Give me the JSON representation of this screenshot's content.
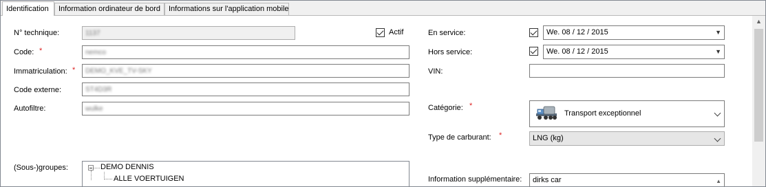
{
  "tabs": [
    {
      "label": "Identification"
    },
    {
      "label": "Information ordinateur de bord"
    },
    {
      "label": "Informations sur l'application mobile"
    }
  ],
  "left": {
    "technical_no": {
      "label": "N° technique:",
      "value": "1137"
    },
    "active": {
      "label": "Actif",
      "checked": true
    },
    "code": {
      "label": "Code:",
      "required": "*",
      "value": "nemco"
    },
    "registration": {
      "label": "Immatriculation:",
      "required": "*",
      "value": "DEMO_KVE_TV-SKY"
    },
    "external_code": {
      "label": "Code externe:",
      "value": "ST4D3R"
    },
    "autofilter": {
      "label": "Autofiltre:",
      "value": "wulke"
    },
    "groups": {
      "label": "(Sous-)groupes:",
      "tree": [
        {
          "label": "DEMO DENNIS",
          "expanded": true
        },
        {
          "label": "ALLE VOERTUIGEN"
        }
      ]
    }
  },
  "right": {
    "in_service": {
      "label": "En service:",
      "checked": true,
      "value": "We. 08 / 12 / 2015"
    },
    "out_of_service": {
      "label": "Hors service:",
      "checked": true,
      "value": "We. 08 / 12 / 2015"
    },
    "vin": {
      "label": "VIN:",
      "value": ""
    },
    "category": {
      "label": "Catégorie:",
      "required": "*",
      "value": "Transport exceptionnel",
      "icon": "truck-icon"
    },
    "fuel_type": {
      "label": "Type de carburant:",
      "required": "*",
      "value": "LNG (kg)"
    },
    "extra_info": {
      "label": "Information supplémentaire:",
      "value": "dirks car"
    }
  },
  "colors": {
    "required": "#dd2222",
    "readonly_bg": "#f0f0f0"
  }
}
